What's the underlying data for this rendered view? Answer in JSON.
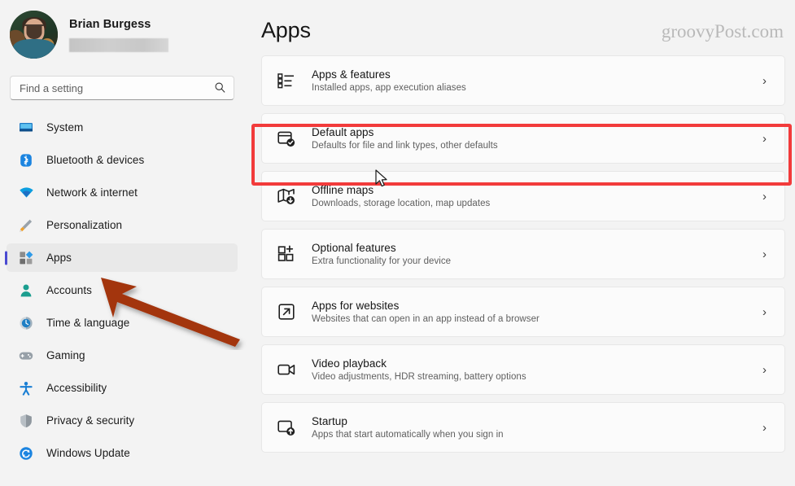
{
  "profile": {
    "name": "Brian Burgess",
    "email_redacted": true,
    "avatar_icon": "user-avatar-photo"
  },
  "search": {
    "placeholder": "Find a setting",
    "value": "",
    "icon": "search-icon"
  },
  "sidebar": {
    "items": [
      {
        "label": "System",
        "icon": "monitor-icon",
        "selected": false
      },
      {
        "label": "Bluetooth & devices",
        "icon": "bluetooth-icon",
        "selected": false
      },
      {
        "label": "Network & internet",
        "icon": "wifi-icon",
        "selected": false
      },
      {
        "label": "Personalization",
        "icon": "paintbrush-icon",
        "selected": false
      },
      {
        "label": "Apps",
        "icon": "apps-grid-icon",
        "selected": true
      },
      {
        "label": "Accounts",
        "icon": "person-icon",
        "selected": false
      },
      {
        "label": "Time & language",
        "icon": "clock-globe-icon",
        "selected": false
      },
      {
        "label": "Gaming",
        "icon": "gamepad-icon",
        "selected": false
      },
      {
        "label": "Accessibility",
        "icon": "accessibility-person-icon",
        "selected": false
      },
      {
        "label": "Privacy & security",
        "icon": "shield-icon",
        "selected": false
      },
      {
        "label": "Windows Update",
        "icon": "update-refresh-icon",
        "selected": false
      }
    ]
  },
  "main": {
    "title": "Apps",
    "watermark": "groovyPost.com",
    "cards": [
      {
        "title": "Apps & features",
        "subtitle": "Installed apps, app execution aliases",
        "icon": "list-view-icon",
        "chevron": "›",
        "highlighted": false
      },
      {
        "title": "Default apps",
        "subtitle": "Defaults for file and link types, other defaults",
        "icon": "default-apps-check-icon",
        "chevron": "›",
        "highlighted": true
      },
      {
        "title": "Offline maps",
        "subtitle": "Downloads, storage location, map updates",
        "icon": "map-download-icon",
        "chevron": "›",
        "highlighted": false
      },
      {
        "title": "Optional features",
        "subtitle": "Extra functionality for your device",
        "icon": "grid-plus-icon",
        "chevron": "›",
        "highlighted": false
      },
      {
        "title": "Apps for websites",
        "subtitle": "Websites that can open in an app instead of a browser",
        "icon": "external-link-icon",
        "chevron": "›",
        "highlighted": false
      },
      {
        "title": "Video playback",
        "subtitle": "Video adjustments, HDR streaming, battery options",
        "icon": "video-camera-icon",
        "chevron": "›",
        "highlighted": false
      },
      {
        "title": "Startup",
        "subtitle": "Apps that start automatically when you sign in",
        "icon": "startup-arrow-icon",
        "chevron": "›",
        "highlighted": false
      }
    ]
  },
  "annotations": {
    "highlight_rect_color": "#f23b3b",
    "arrow_color": "#a33511",
    "arrow_points_to": "Apps",
    "cursor_icon": "mouse-pointer-icon"
  },
  "colors": {
    "page_background": "#f3f3f3",
    "card_background": "#fbfbfb",
    "selected_accent": "#4a4ad1",
    "text_primary": "#161616",
    "text_secondary": "#5f5f5f"
  }
}
